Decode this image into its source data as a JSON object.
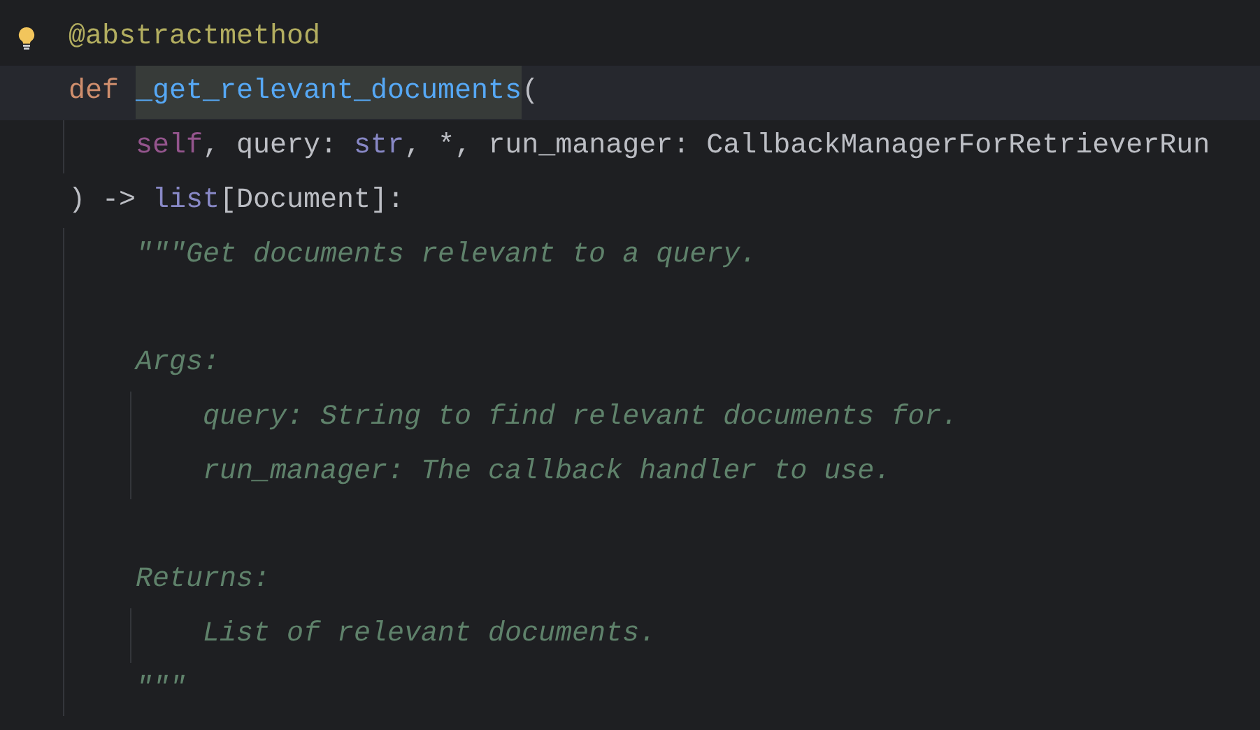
{
  "editor": {
    "lines": [
      {
        "kind": "code",
        "current": false,
        "hint_bulb": true,
        "tokens": [
          {
            "kind": "decorator",
            "text": "@abstractmethod",
            "highlighted": false
          }
        ]
      },
      {
        "kind": "code",
        "current": true,
        "hint_bulb": false,
        "tokens": [
          {
            "kind": "keyword",
            "text": "def ",
            "highlighted": false
          },
          {
            "kind": "function",
            "text": "_get_relevant_documents",
            "highlighted": true
          },
          {
            "kind": "plain",
            "text": "(",
            "highlighted": false
          }
        ]
      },
      {
        "kind": "code",
        "current": false,
        "hint_bulb": false,
        "tokens": [
          {
            "kind": "self",
            "text": "    self",
            "highlighted": false
          },
          {
            "kind": "plain",
            "text": ", query: ",
            "highlighted": false
          },
          {
            "kind": "builtin",
            "text": "str",
            "highlighted": false
          },
          {
            "kind": "plain",
            "text": ", *, run_manager: CallbackManagerForRetrieverRun",
            "highlighted": false
          }
        ]
      },
      {
        "kind": "code",
        "current": false,
        "hint_bulb": false,
        "tokens": [
          {
            "kind": "plain",
            "text": ") -> ",
            "highlighted": false
          },
          {
            "kind": "builtin",
            "text": "list",
            "highlighted": false
          },
          {
            "kind": "plain",
            "text": "[Document]:",
            "highlighted": false
          }
        ]
      },
      {
        "kind": "code",
        "current": false,
        "hint_bulb": false,
        "tokens": [
          {
            "kind": "docstring",
            "text": "    \"\"\"Get documents relevant to a query.",
            "highlighted": false
          }
        ]
      },
      {
        "kind": "blank"
      },
      {
        "kind": "code",
        "current": false,
        "hint_bulb": false,
        "tokens": [
          {
            "kind": "docstring",
            "text": "    Args:",
            "highlighted": false
          }
        ]
      },
      {
        "kind": "code",
        "current": false,
        "hint_bulb": false,
        "tokens": [
          {
            "kind": "docstring",
            "text": "        query: String to find relevant documents for.",
            "highlighted": false
          }
        ]
      },
      {
        "kind": "code",
        "current": false,
        "hint_bulb": false,
        "tokens": [
          {
            "kind": "docstring",
            "text": "        run_manager: The callback handler to use.",
            "highlighted": false
          }
        ]
      },
      {
        "kind": "blank"
      },
      {
        "kind": "code",
        "current": false,
        "hint_bulb": false,
        "tokens": [
          {
            "kind": "docstring",
            "text": "    Returns:",
            "highlighted": false
          }
        ]
      },
      {
        "kind": "code",
        "current": false,
        "hint_bulb": false,
        "tokens": [
          {
            "kind": "docstring",
            "text": "        List of relevant documents.",
            "highlighted": false
          }
        ]
      },
      {
        "kind": "code",
        "current": false,
        "hint_bulb": false,
        "tokens": [
          {
            "kind": "docstring",
            "text": "    \"\"\"",
            "highlighted": false
          }
        ]
      }
    ]
  }
}
